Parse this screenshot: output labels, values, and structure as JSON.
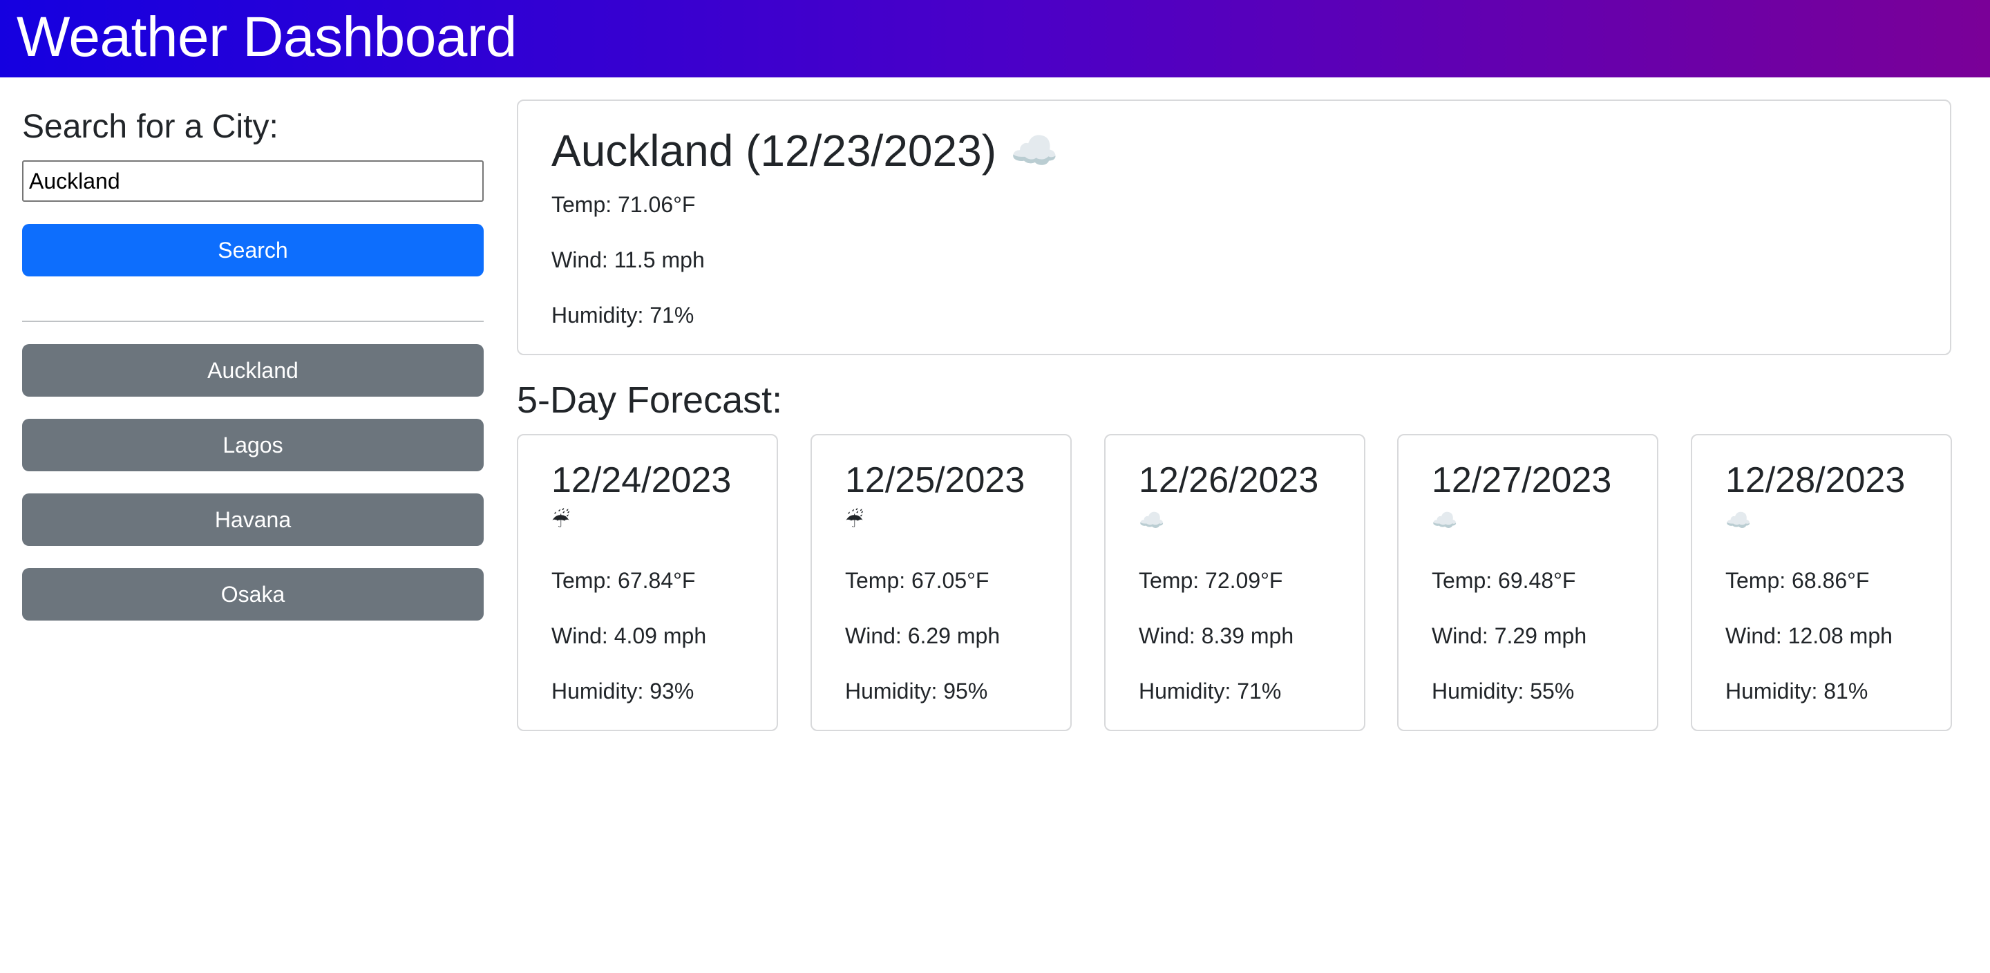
{
  "header": {
    "title": "Weather Dashboard"
  },
  "search": {
    "label": "Search for a City:",
    "value": "Auckland",
    "button_label": "Search"
  },
  "history": [
    "Auckland",
    "Lagos",
    "Havana",
    "Osaka"
  ],
  "current": {
    "title": "Auckland (12/23/2023)",
    "icon": "☁️",
    "temp": "Temp: 71.06°F",
    "wind": "Wind: 11.5 mph",
    "humidity": "Humidity: 71%"
  },
  "forecast": {
    "title": "5-Day Forecast:",
    "days": [
      {
        "date": "12/24/2023",
        "icon": "☔",
        "temp": "Temp: 67.84°F",
        "wind": "Wind: 4.09 mph",
        "humidity": "Humidity: 93%"
      },
      {
        "date": "12/25/2023",
        "icon": "☔",
        "temp": "Temp: 67.05°F",
        "wind": "Wind: 6.29 mph",
        "humidity": "Humidity: 95%"
      },
      {
        "date": "12/26/2023",
        "icon": "☁️",
        "temp": "Temp: 72.09°F",
        "wind": "Wind: 8.39 mph",
        "humidity": "Humidity: 71%"
      },
      {
        "date": "12/27/2023",
        "icon": "☁️",
        "temp": "Temp: 69.48°F",
        "wind": "Wind: 7.29 mph",
        "humidity": "Humidity: 55%"
      },
      {
        "date": "12/28/2023",
        "icon": "☁️",
        "temp": "Temp: 68.86°F",
        "wind": "Wind: 12.08 mph",
        "humidity": "Humidity: 81%"
      }
    ]
  },
  "colors": {
    "header_gradient_start": "#1500e0",
    "header_gradient_end": "#7a0098",
    "primary_button": "#0d6efd",
    "history_button": "#6c757d"
  }
}
